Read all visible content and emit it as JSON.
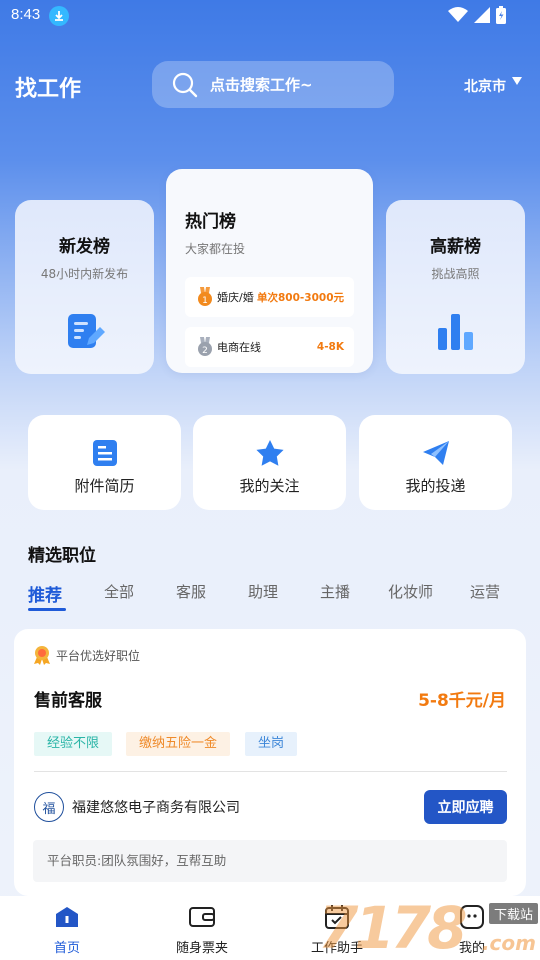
{
  "status": {
    "time": "8:43"
  },
  "header": {
    "title": "找工作",
    "search_placeholder": "点击搜索工作~",
    "city": "北京市"
  },
  "rank_cards": {
    "new": {
      "title": "新发榜",
      "subtitle": "48小时内新发布"
    },
    "hot": {
      "title": "热门榜",
      "subtitle": "大家都在投",
      "items": [
        {
          "rank": "1",
          "name": "婚庆/婚",
          "salary": "单次800-3000元"
        },
        {
          "rank": "2",
          "name": "电商在线",
          "salary": "4-8K"
        }
      ]
    },
    "high": {
      "title": "高薪榜",
      "subtitle": "挑战高照"
    }
  },
  "quick_actions": [
    {
      "label": "附件简历"
    },
    {
      "label": "我的关注"
    },
    {
      "label": "我的投递"
    }
  ],
  "section": {
    "title": "精选职位"
  },
  "tabs": [
    "推荐",
    "全部",
    "客服",
    "助理",
    "主播",
    "化妆师",
    "运营"
  ],
  "job": {
    "badge": "平台优选好职位",
    "title": "售前客服",
    "salary": "5-8千元/月",
    "tags": [
      "经验不限",
      "缴纳五险一金",
      "坐岗"
    ],
    "company_logo": "福",
    "company": "福建悠悠电子商务有限公司",
    "apply_label": "立即应聘",
    "note": "平台职员:团队氛围好，互帮互助"
  },
  "bottom_nav": [
    {
      "label": "首页",
      "icon": "home-icon"
    },
    {
      "label": "随身票夹",
      "icon": "wallet-icon"
    },
    {
      "label": "工作助手",
      "icon": "calendar-icon"
    },
    {
      "label": "我的",
      "icon": "profile-icon"
    }
  ],
  "watermark": {
    "digits": "7178",
    "badge": "下载站",
    "suffix": ".com"
  },
  "colors": {
    "primary": "#1f5bd8",
    "accent": "#f27a10",
    "button": "#2356c6"
  }
}
